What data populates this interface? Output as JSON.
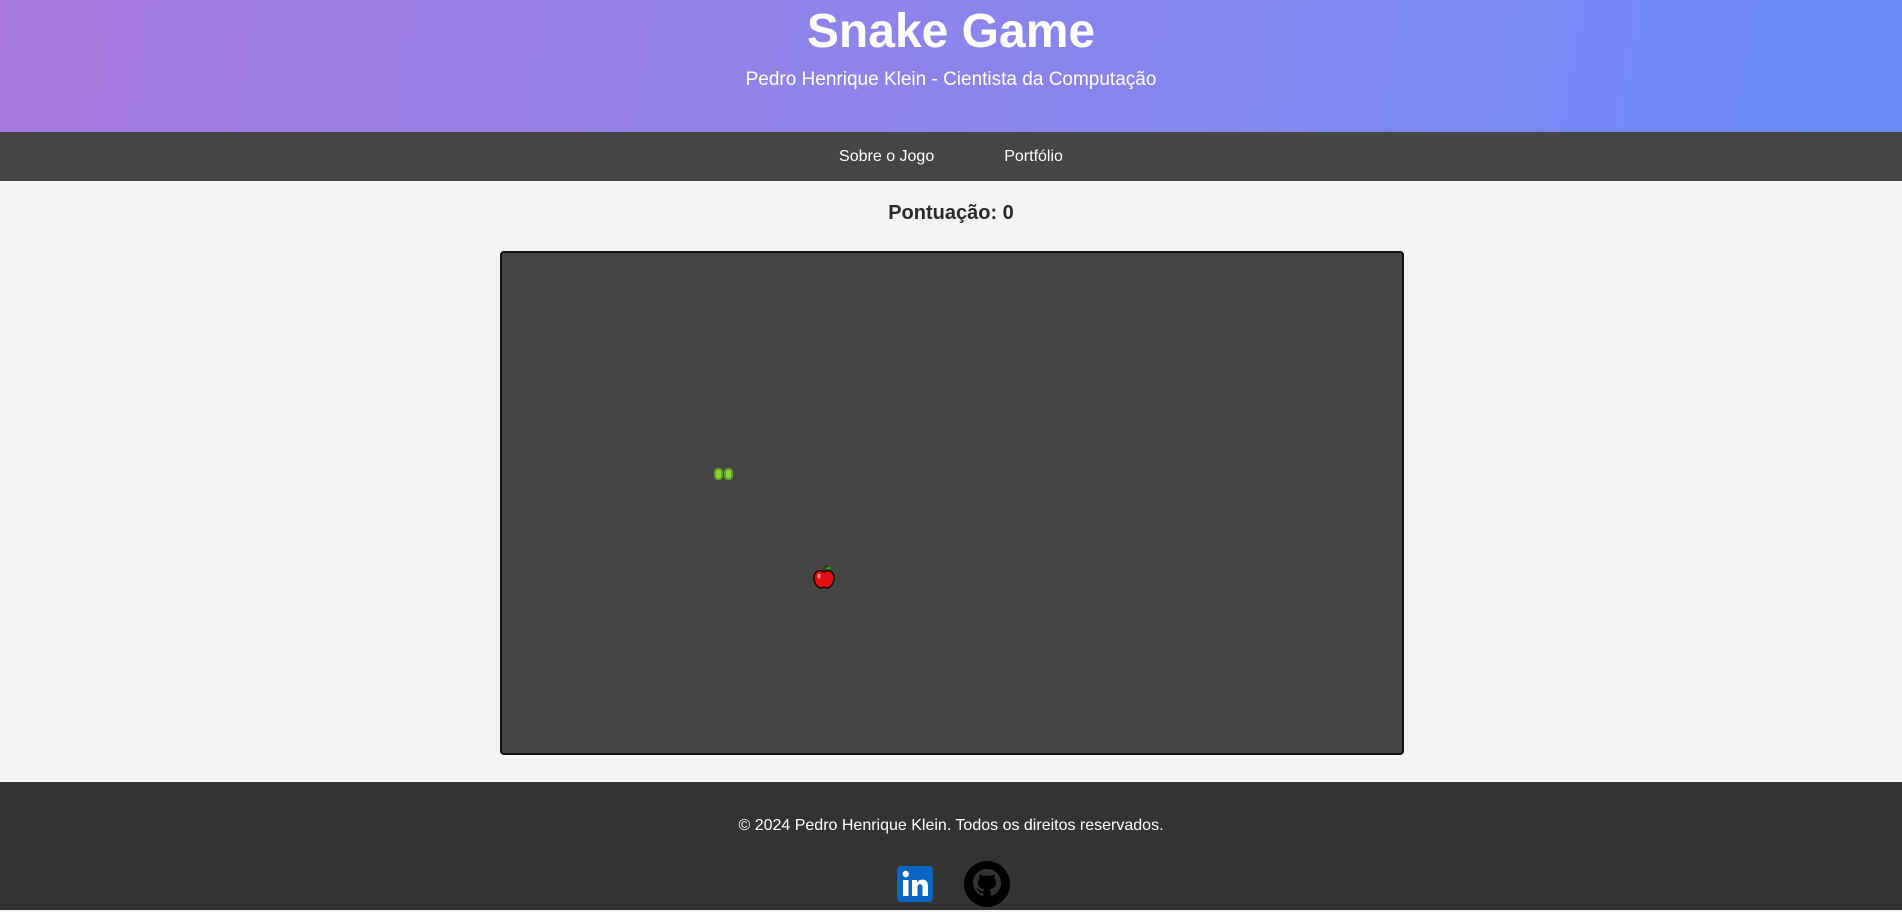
{
  "header": {
    "title": "Snake Game",
    "subtitle": "Pedro Henrique Klein - Cientista da Computação"
  },
  "nav": {
    "items": [
      {
        "label": "Sobre o Jogo"
      },
      {
        "label": "Portfólio"
      }
    ]
  },
  "game": {
    "score_text": "Pontuação: 0",
    "score": 0,
    "snake_color": "#8bd13a",
    "board_color": "#454545",
    "food_icon": "apple-icon"
  },
  "footer": {
    "copyright": "© 2024 Pedro Henrique Klein. Todos os direitos reservados.",
    "social": [
      {
        "icon": "linkedin-icon",
        "color": "#0a66c2"
      },
      {
        "icon": "github-icon",
        "color": "#000000"
      }
    ]
  },
  "colors": {
    "header_gradient_start": "#a97be0",
    "header_gradient_end": "#6b8dfa",
    "nav_bg": "#454545",
    "footer_bg": "#333333",
    "page_bg": "#f4f4f4"
  }
}
